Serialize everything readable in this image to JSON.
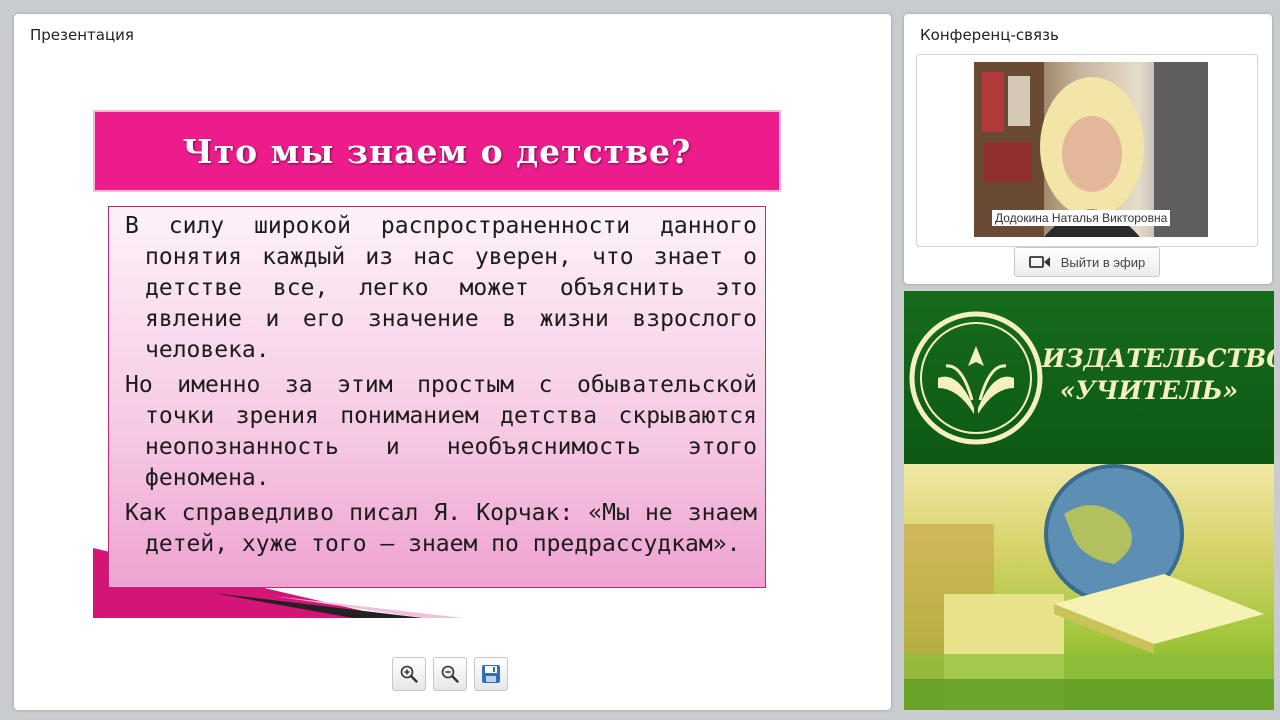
{
  "presentation": {
    "title": "Презентация",
    "slide": {
      "heading": "Что мы знаем о детстве?",
      "paragraphs": [
        "В силу широкой распространенности данного понятия каждый из нас уверен, что знает о детстве все, легко может объяснить это явление и его значение в жизни взрослого человека.",
        "Но именно за этим простым с обывательской точки зрения пониманием детства скрываются неопознанность и необъяснимость этого феномена.",
        "Как справедливо писал Я. Корчак: «Мы не знаем детей, хуже того — знаем по предрассудкам»."
      ]
    },
    "toolbar": {
      "zoom_in_icon": "zoom-in-icon",
      "zoom_out_icon": "zoom-out-icon",
      "save_icon": "floppy-disk-icon"
    }
  },
  "conference": {
    "title": "Конференц-связь",
    "speaker_name": "Додокина Наталья Викторовна",
    "go_live_label": "Выйти в эфир",
    "go_live_icon": "video-camera-icon"
  },
  "banner": {
    "publisher_line1": "ИЗДАТЕЛЬСТВО",
    "publisher_line2": "«УЧИТЕЛЬ»",
    "logo_icon": "open-book-torch-logo-icon"
  },
  "colors": {
    "slide_accent": "#ec1c8c",
    "banner_green": "#166b1d",
    "logo_gold": "#f5f0c0"
  }
}
